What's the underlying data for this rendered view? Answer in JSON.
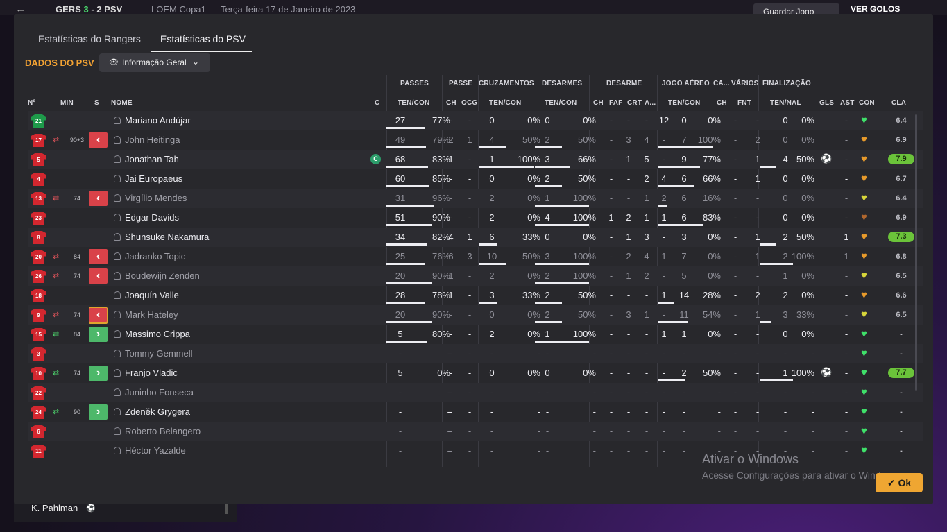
{
  "topbar": {
    "back": "←",
    "home": "GERS",
    "score_home": "3",
    "score_sep": "-",
    "score_away": "2",
    "away": "PSV",
    "competition": "LOEM Copa1",
    "date": "Terça-feira 17 de Janeiro de 2023",
    "save_label": "Guardar Jogo",
    "goals_label": "VER GOLOS"
  },
  "bottom_strip": {
    "name": "K. Pahlman",
    "icon": "⚽"
  },
  "tabs": [
    {
      "label": "Estatísticas do Rangers"
    },
    {
      "label": "Estatísticas do PSV"
    }
  ],
  "section_title": "DADOS DO PSV",
  "dropdown": {
    "label": "Informação Geral",
    "eye": "👁",
    "chev": "⌄"
  },
  "group_headers": {
    "passes": "PASSES",
    "passe": "PASSE",
    "cruz": "CRUZAMENTOS",
    "desarmes": "DESARMES",
    "desarme": "DESARME",
    "jogo_aereo": "JOGO AÉREO",
    "ca": "CA...",
    "varios": "VÁRIOS",
    "finalizacao": "FINALIZAÇÃO"
  },
  "col_headers": {
    "no": "Nº",
    "min": "MIN",
    "s": "S",
    "nome": "NOME",
    "c": "C",
    "passes_tc": "TEN/CON",
    "passe_ch": "CH",
    "passe_ocg": "OCG",
    "cruz_tc": "TEN/CON",
    "des_tc": "TEN/CON",
    "d_ch": "CH",
    "d_faf": "FAF",
    "d_crt": "CRT",
    "d_a": "A...",
    "aereo_tc": "TEN/CON",
    "ca_ch": "CH",
    "fnt": "FNT",
    "fin_tn": "TEN/NAL",
    "gls": "GLS",
    "ast": "AST",
    "con": "CON",
    "cla": "CLA"
  },
  "colors": {
    "accent": "#f2a233",
    "sub_out": "#d94249",
    "sub_in": "#4db86a",
    "best_rating": "#6bc33a"
  },
  "players": [
    {
      "no": "21",
      "gk": true,
      "min": "",
      "s": "",
      "name": "Mariano Andújar",
      "dim": false,
      "cap": false,
      "pa": "27",
      "pp": "77%",
      "pb": 0.77,
      "pch": "-",
      "pocg": "-",
      "ca": "0",
      "cp": "0%",
      "cb": 0,
      "da": "0",
      "dp": "0%",
      "db": 0,
      "dch": "-",
      "dfaf": "-",
      "dcrt": "-",
      "dai": "12",
      "aa": "0",
      "ap": "0%",
      "ab": 0,
      "cach": "-",
      "fnt": "-",
      "fa": "0",
      "fp": "0%",
      "fb": 0,
      "gls": "",
      "ast": "-",
      "con": "green",
      "cla": "6.4",
      "best": false
    },
    {
      "no": "17",
      "min": "90+3",
      "s": "out",
      "name": "John Heitinga",
      "dim": true,
      "cap": false,
      "pa": "49",
      "pp": "79%",
      "pb": 0.79,
      "pch": "2",
      "pocg": "1",
      "ca": "4",
      "cp": "50%",
      "cb": 0.5,
      "da": "2",
      "dp": "50%",
      "db": 0.5,
      "dch": "-",
      "dfaf": "3",
      "dcrt": "4",
      "dai": "-",
      "aa": "7",
      "ap": "100%",
      "ab": 1,
      "cach": "-",
      "fnt": "2",
      "fa": "0",
      "fp": "0%",
      "fb": 0,
      "gls": "",
      "ast": "-",
      "con": "orange",
      "cla": "6.9",
      "best": false
    },
    {
      "no": "5",
      "min": "",
      "s": "",
      "name": "Jonathan Tah",
      "dim": false,
      "cap": true,
      "cap_label": "C",
      "pa": "68",
      "pp": "83%",
      "pb": 0.83,
      "pch": "1",
      "pocg": "-",
      "ca": "1",
      "cp": "100%",
      "cb": 1,
      "da": "3",
      "dp": "66%",
      "db": 0.66,
      "dch": "-",
      "dfaf": "1",
      "dcrt": "5",
      "dai": "-",
      "aa": "9",
      "ap": "77%",
      "ab": 0.77,
      "cach": "-",
      "fnt": "1",
      "fa": "4",
      "fp": "50%",
      "fb": 0.5,
      "gls": "⚽",
      "ast": "-",
      "con": "orange",
      "cla": "7.9",
      "best": true
    },
    {
      "no": "4",
      "min": "",
      "s": "",
      "name": "Jai Europaeus",
      "dim": false,
      "cap": false,
      "pa": "60",
      "pp": "85%",
      "pb": 0.85,
      "pch": "-",
      "pocg": "-",
      "ca": "0",
      "cp": "0%",
      "cb": 0,
      "da": "2",
      "dp": "50%",
      "db": 0.5,
      "dch": "-",
      "dfaf": "-",
      "dcrt": "2",
      "dai": "4",
      "aa": "6",
      "ap": "66%",
      "ab": 0.66,
      "cach": "-",
      "fnt": "1",
      "fa": "0",
      "fp": "0%",
      "fb": 0,
      "gls": "",
      "ast": "-",
      "con": "orange",
      "cla": "6.7",
      "best": false
    },
    {
      "no": "13",
      "min": "74",
      "s": "out",
      "name": "Virgílio Mendes",
      "dim": true,
      "cap": false,
      "pa": "31",
      "pp": "96%",
      "pb": 0.96,
      "pch": "-",
      "pocg": "-",
      "ca": "2",
      "cp": "0%",
      "cb": 0,
      "da": "1",
      "dp": "100%",
      "db": 1,
      "dch": "-",
      "dfaf": "-",
      "dcrt": "1",
      "dai": "2",
      "aa": "6",
      "ap": "16%",
      "ab": 0.16,
      "cach": "-",
      "fnt": "-",
      "fa": "0",
      "fp": "0%",
      "fb": 0,
      "gls": "",
      "ast": "-",
      "con": "yellow",
      "cla": "6.4",
      "best": false
    },
    {
      "no": "23",
      "min": "",
      "s": "",
      "name": "Edgar Davids",
      "dim": false,
      "cap": false,
      "pa": "51",
      "pp": "90%",
      "pb": 0.9,
      "pch": "-",
      "pocg": "-",
      "ca": "2",
      "cp": "0%",
      "cb": 0,
      "da": "4",
      "dp": "100%",
      "db": 1,
      "dch": "1",
      "dfaf": "2",
      "dcrt": "1",
      "dai": "1",
      "aa": "6",
      "ap": "83%",
      "ab": 0.83,
      "cach": "-",
      "fnt": "-",
      "fa": "0",
      "fp": "0%",
      "fb": 0,
      "gls": "",
      "ast": "-",
      "con": "brown",
      "cla": "6.9",
      "best": false
    },
    {
      "no": "8",
      "min": "",
      "s": "",
      "name": "Shunsuke Nakamura",
      "dim": false,
      "cap": false,
      "pa": "34",
      "pp": "82%",
      "pb": 0.82,
      "pch": "4",
      "pocg": "1",
      "ca": "6",
      "cp": "33%",
      "cb": 0.33,
      "da": "0",
      "dp": "0%",
      "db": 0,
      "dch": "-",
      "dfaf": "1",
      "dcrt": "3",
      "dai": "-",
      "aa": "3",
      "ap": "0%",
      "ab": 0,
      "cach": "-",
      "fnt": "1",
      "fa": "2",
      "fp": "50%",
      "fb": 0.5,
      "gls": "",
      "ast": "1",
      "con": "orange",
      "cla": "7.3",
      "best": true
    },
    {
      "no": "20",
      "min": "84",
      "s": "out",
      "name": "Jadranko Topic",
      "dim": true,
      "cap": false,
      "pa": "25",
      "pp": "76%",
      "pb": 0.76,
      "pch": "6",
      "pocg": "3",
      "ca": "10",
      "cp": "50%",
      "cb": 0.5,
      "da": "3",
      "dp": "100%",
      "db": 1,
      "dch": "-",
      "dfaf": "2",
      "dcrt": "4",
      "dai": "1",
      "aa": "7",
      "ap": "0%",
      "ab": 0,
      "cach": "-",
      "fnt": "1",
      "fa": "2",
      "fp": "100%",
      "fb": 1,
      "gls": "",
      "ast": "1",
      "con": "orange",
      "cla": "6.8",
      "best": false
    },
    {
      "no": "26",
      "min": "74",
      "s": "out",
      "name": "Boudewijn Zenden",
      "dim": true,
      "cap": false,
      "pa": "20",
      "pp": "90%",
      "pb": 0.9,
      "pch": "1",
      "pocg": "-",
      "ca": "2",
      "cp": "0%",
      "cb": 0,
      "da": "2",
      "dp": "100%",
      "db": 1,
      "dch": "-",
      "dfaf": "1",
      "dcrt": "2",
      "dai": "-",
      "aa": "5",
      "ap": "0%",
      "ab": 0,
      "cach": "-",
      "fnt": "-",
      "fa": "1",
      "fp": "0%",
      "fb": 0,
      "gls": "",
      "ast": "-",
      "con": "yellow",
      "cla": "6.5",
      "best": false
    },
    {
      "no": "18",
      "min": "",
      "s": "",
      "name": "Joaquín Valle",
      "dim": false,
      "cap": false,
      "pa": "28",
      "pp": "78%",
      "pb": 0.78,
      "pch": "1",
      "pocg": "-",
      "ca": "3",
      "cp": "33%",
      "cb": 0.33,
      "da": "2",
      "dp": "50%",
      "db": 0.5,
      "dch": "-",
      "dfaf": "-",
      "dcrt": "-",
      "dai": "1",
      "aa": "14",
      "ap": "28%",
      "ab": 0.28,
      "cach": "-",
      "fnt": "2",
      "fa": "2",
      "fp": "0%",
      "fb": 0,
      "gls": "",
      "ast": "-",
      "con": "orange",
      "cla": "6.6",
      "best": false
    },
    {
      "no": "9",
      "min": "74",
      "s": "outsel",
      "name": "Mark Hateley",
      "dim": true,
      "cap": false,
      "pa": "20",
      "pp": "90%",
      "pb": 0.9,
      "pch": "-",
      "pocg": "-",
      "ca": "0",
      "cp": "0%",
      "cb": 0,
      "da": "2",
      "dp": "50%",
      "db": 0.5,
      "dch": "-",
      "dfaf": "3",
      "dcrt": "1",
      "dai": "-",
      "aa": "11",
      "ap": "54%",
      "ab": 0.54,
      "cach": "-",
      "fnt": "1",
      "fa": "3",
      "fp": "33%",
      "fb": 0.33,
      "gls": "",
      "ast": "-",
      "con": "yellow",
      "cla": "6.5",
      "best": false
    },
    {
      "no": "15",
      "min": "84",
      "s": "in",
      "name": "Massimo Crippa",
      "dim": false,
      "cap": false,
      "pa": "5",
      "pp": "80%",
      "pb": 0.8,
      "pch": "-",
      "pocg": "-",
      "ca": "2",
      "cp": "0%",
      "cb": 0,
      "da": "1",
      "dp": "100%",
      "db": 1,
      "dch": "-",
      "dfaf": "-",
      "dcrt": "-",
      "dai": "1",
      "aa": "1",
      "ap": "0%",
      "ab": 0,
      "cach": "-",
      "fnt": "-",
      "fa": "0",
      "fp": "0%",
      "fb": 0,
      "gls": "",
      "ast": "-",
      "con": "green",
      "cla": "-",
      "best": false
    },
    {
      "no": "3",
      "min": "",
      "s": "",
      "name": "Tommy Gemmell",
      "dim": true,
      "cap": false,
      "pa": "-",
      "pp": "-",
      "pb": -1,
      "pch": "-",
      "pocg": "-",
      "ca": "-",
      "cp": "-",
      "cb": -1,
      "da": "-",
      "dp": "-",
      "db": -1,
      "dch": "-",
      "dfaf": "-",
      "dcrt": "-",
      "dai": "-",
      "aa": "-",
      "ap": "-",
      "ab": -1,
      "cach": "-",
      "fnt": "-",
      "fa": "-",
      "fp": "-",
      "fb": -1,
      "gls": "",
      "ast": "-",
      "con": "green",
      "cla": "-",
      "best": false
    },
    {
      "no": "10",
      "min": "74",
      "s": "in",
      "name": "Franjo Vladic",
      "dim": false,
      "cap": false,
      "pa": "5",
      "pp": "0%",
      "pb": 0,
      "pch": "-",
      "pocg": "-",
      "ca": "0",
      "cp": "0%",
      "cb": 0,
      "da": "0",
      "dp": "0%",
      "db": 0,
      "dch": "-",
      "dfaf": "-",
      "dcrt": "-",
      "dai": "-",
      "aa": "2",
      "ap": "50%",
      "ab": 0.5,
      "cach": "-",
      "fnt": "-",
      "fa": "1",
      "fp": "100%",
      "fb": 1,
      "gls": "⚽",
      "ast": "-",
      "con": "green",
      "cla": "7.7",
      "best": true
    },
    {
      "no": "22",
      "min": "",
      "s": "",
      "name": "Juninho Fonseca",
      "dim": true,
      "cap": false,
      "pa": "-",
      "pp": "-",
      "pb": -1,
      "pch": "-",
      "pocg": "-",
      "ca": "-",
      "cp": "-",
      "cb": -1,
      "da": "-",
      "dp": "-",
      "db": -1,
      "dch": "-",
      "dfaf": "-",
      "dcrt": "-",
      "dai": "-",
      "aa": "-",
      "ap": "-",
      "ab": -1,
      "cach": "-",
      "fnt": "-",
      "fa": "-",
      "fp": "-",
      "fb": -1,
      "gls": "",
      "ast": "-",
      "con": "green",
      "cla": "-",
      "best": false
    },
    {
      "no": "24",
      "min": "90",
      "s": "in",
      "name": "Zdeněk Grygera",
      "dim": false,
      "cap": false,
      "pa": "-",
      "pp": "-",
      "pb": -1,
      "pch": "-",
      "pocg": "-",
      "ca": "-",
      "cp": "-",
      "cb": -1,
      "da": "-",
      "dp": "-",
      "db": -1,
      "dch": "-",
      "dfaf": "-",
      "dcrt": "-",
      "dai": "-",
      "aa": "-",
      "ap": "-",
      "ab": -1,
      "cach": "-",
      "fnt": "-",
      "fa": "-",
      "fp": "-",
      "fb": -1,
      "gls": "",
      "ast": "-",
      "con": "green",
      "cla": "-",
      "best": false
    },
    {
      "no": "6",
      "min": "",
      "s": "",
      "name": "Roberto Belangero",
      "dim": true,
      "cap": false,
      "pa": "-",
      "pp": "-",
      "pb": -1,
      "pch": "-",
      "pocg": "-",
      "ca": "-",
      "cp": "-",
      "cb": -1,
      "da": "-",
      "dp": "-",
      "db": -1,
      "dch": "-",
      "dfaf": "-",
      "dcrt": "-",
      "dai": "-",
      "aa": "-",
      "ap": "-",
      "ab": -1,
      "cach": "-",
      "fnt": "-",
      "fa": "-",
      "fp": "-",
      "fb": -1,
      "gls": "",
      "ast": "-",
      "con": "green",
      "cla": "-",
      "best": false
    },
    {
      "no": "11",
      "min": "",
      "s": "",
      "name": "Héctor Yazalde",
      "dim": true,
      "cap": false,
      "pa": "-",
      "pp": "-",
      "pb": -1,
      "pch": "-",
      "pocg": "-",
      "ca": "-",
      "cp": "-",
      "cb": -1,
      "da": "-",
      "dp": "-",
      "db": -1,
      "dch": "-",
      "dfaf": "-",
      "dcrt": "-",
      "dai": "-",
      "aa": "-",
      "ap": "-",
      "ab": -1,
      "cach": "-",
      "fnt": "-",
      "fa": "-",
      "fp": "-",
      "fb": -1,
      "gls": "",
      "ast": "-",
      "con": "green",
      "cla": "-",
      "best": false
    }
  ],
  "watermark": {
    "title": "Ativar o Windows",
    "sub": "Acesse Configurações para ativar o Windows."
  },
  "ok_label": "Ok",
  "ok_icon": "✔"
}
